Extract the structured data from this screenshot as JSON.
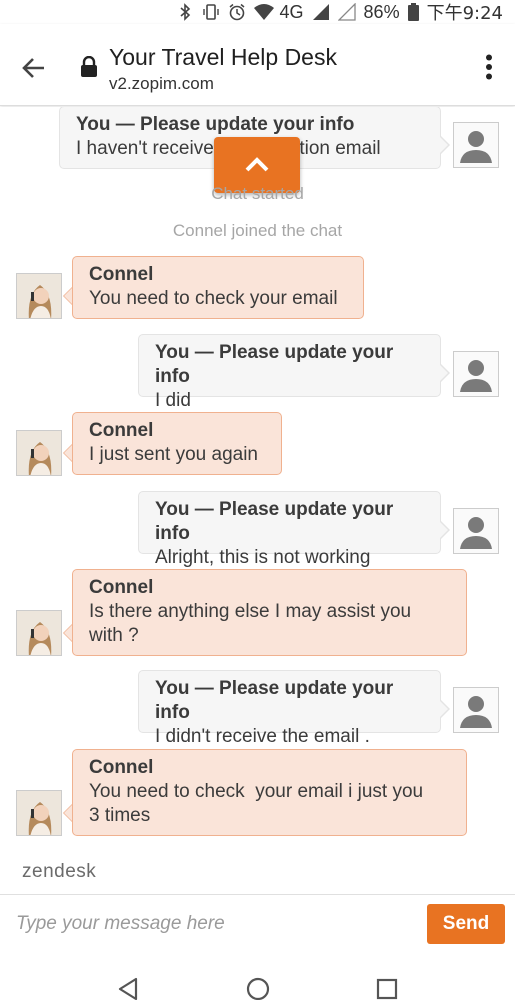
{
  "status_bar": {
    "network": "4G",
    "battery": "86%",
    "time": "下午9:24",
    "icons": [
      "bluetooth-icon",
      "vibrate-icon",
      "alarm-icon",
      "wifi-icon",
      "signal-icon",
      "battery-icon"
    ]
  },
  "browser": {
    "title": "Your Travel Help Desk",
    "url": "v2.zopim.com"
  },
  "chat": {
    "messages": [
      {
        "sender": "you",
        "name": "You — Please update your info",
        "lines": [
          "I haven't received cancellation email"
        ]
      },
      {
        "sender": "agent",
        "name": "Connel",
        "lines": [
          "You need to check your email"
        ]
      },
      {
        "sender": "you",
        "name": "You — Please update your info",
        "lines": [
          "I did"
        ]
      },
      {
        "sender": "agent",
        "name": "Connel",
        "lines": [
          "I just sent you again"
        ]
      },
      {
        "sender": "you",
        "name": "You — Please update your info",
        "lines": [
          "Alright, this is not working"
        ]
      },
      {
        "sender": "agent",
        "name": "Connel",
        "lines": [
          "Is there anything else I may assist you",
          "with ?"
        ]
      },
      {
        "sender": "you",
        "name": "You — Please update your info",
        "lines": [
          "I didn't receive the email ."
        ]
      },
      {
        "sender": "agent",
        "name": "Connel",
        "lines": [
          "You need to check  your email i just you",
          "3 times"
        ]
      }
    ],
    "system": {
      "chat_started": "Chat started",
      "joined": "Connel joined the chat"
    },
    "branding": "zendesk"
  },
  "input": {
    "placeholder": "Type your message here",
    "send_label": "Send"
  },
  "colors": {
    "accent": "#e87322",
    "agent_bubble": "#fae4d9",
    "agent_border": "#f0b18f",
    "you_bubble": "#f6f6f6"
  }
}
